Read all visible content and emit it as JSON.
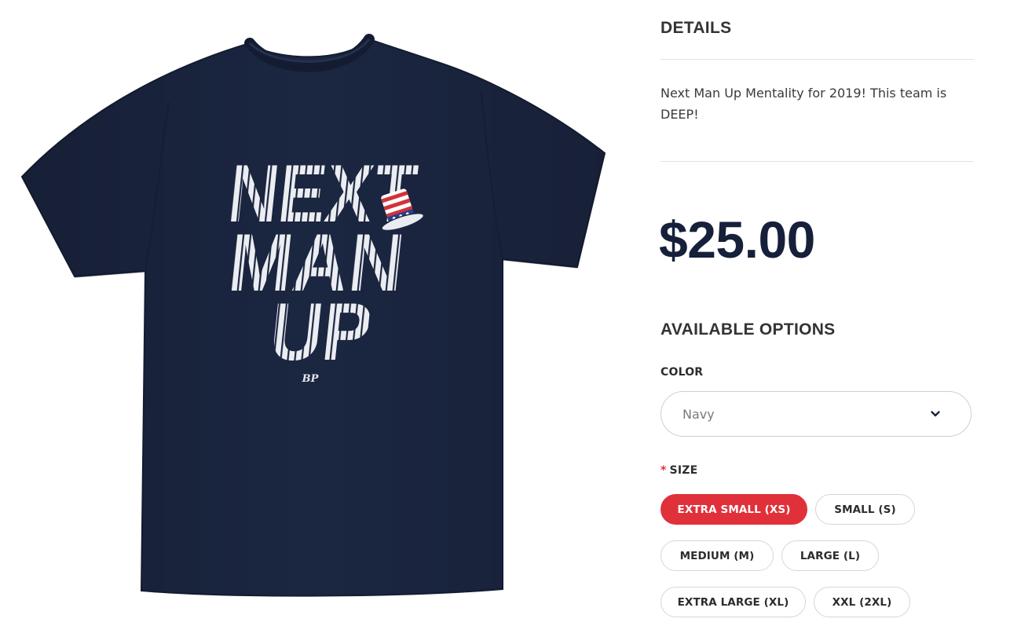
{
  "product": {
    "shirt_text_lines": [
      "NEXT",
      "MAN",
      "UP"
    ],
    "shirt_logo": "BP",
    "shirt_color": "#1b2641"
  },
  "details": {
    "heading": "DETAILS",
    "description": "Next Man Up Mentality for 2019! This team is DEEP!"
  },
  "price": "$25.00",
  "options": {
    "heading": "AVAILABLE OPTIONS",
    "color": {
      "label": "COLOR",
      "selected": "Navy",
      "icon": "chevron-down-icon"
    },
    "size": {
      "required_marker": "*",
      "label": "SIZE",
      "choices": [
        {
          "label": "EXTRA SMALL (XS)",
          "selected": true
        },
        {
          "label": "SMALL (S)",
          "selected": false
        },
        {
          "label": "MEDIUM (M)",
          "selected": false
        },
        {
          "label": "LARGE (L)",
          "selected": false
        },
        {
          "label": "EXTRA LARGE (XL)",
          "selected": false
        },
        {
          "label": "XXL (2XL)",
          "selected": false
        }
      ]
    }
  },
  "colors": {
    "accent": "#e0313b",
    "price": "#16203a",
    "shirt": "#1b2641"
  }
}
